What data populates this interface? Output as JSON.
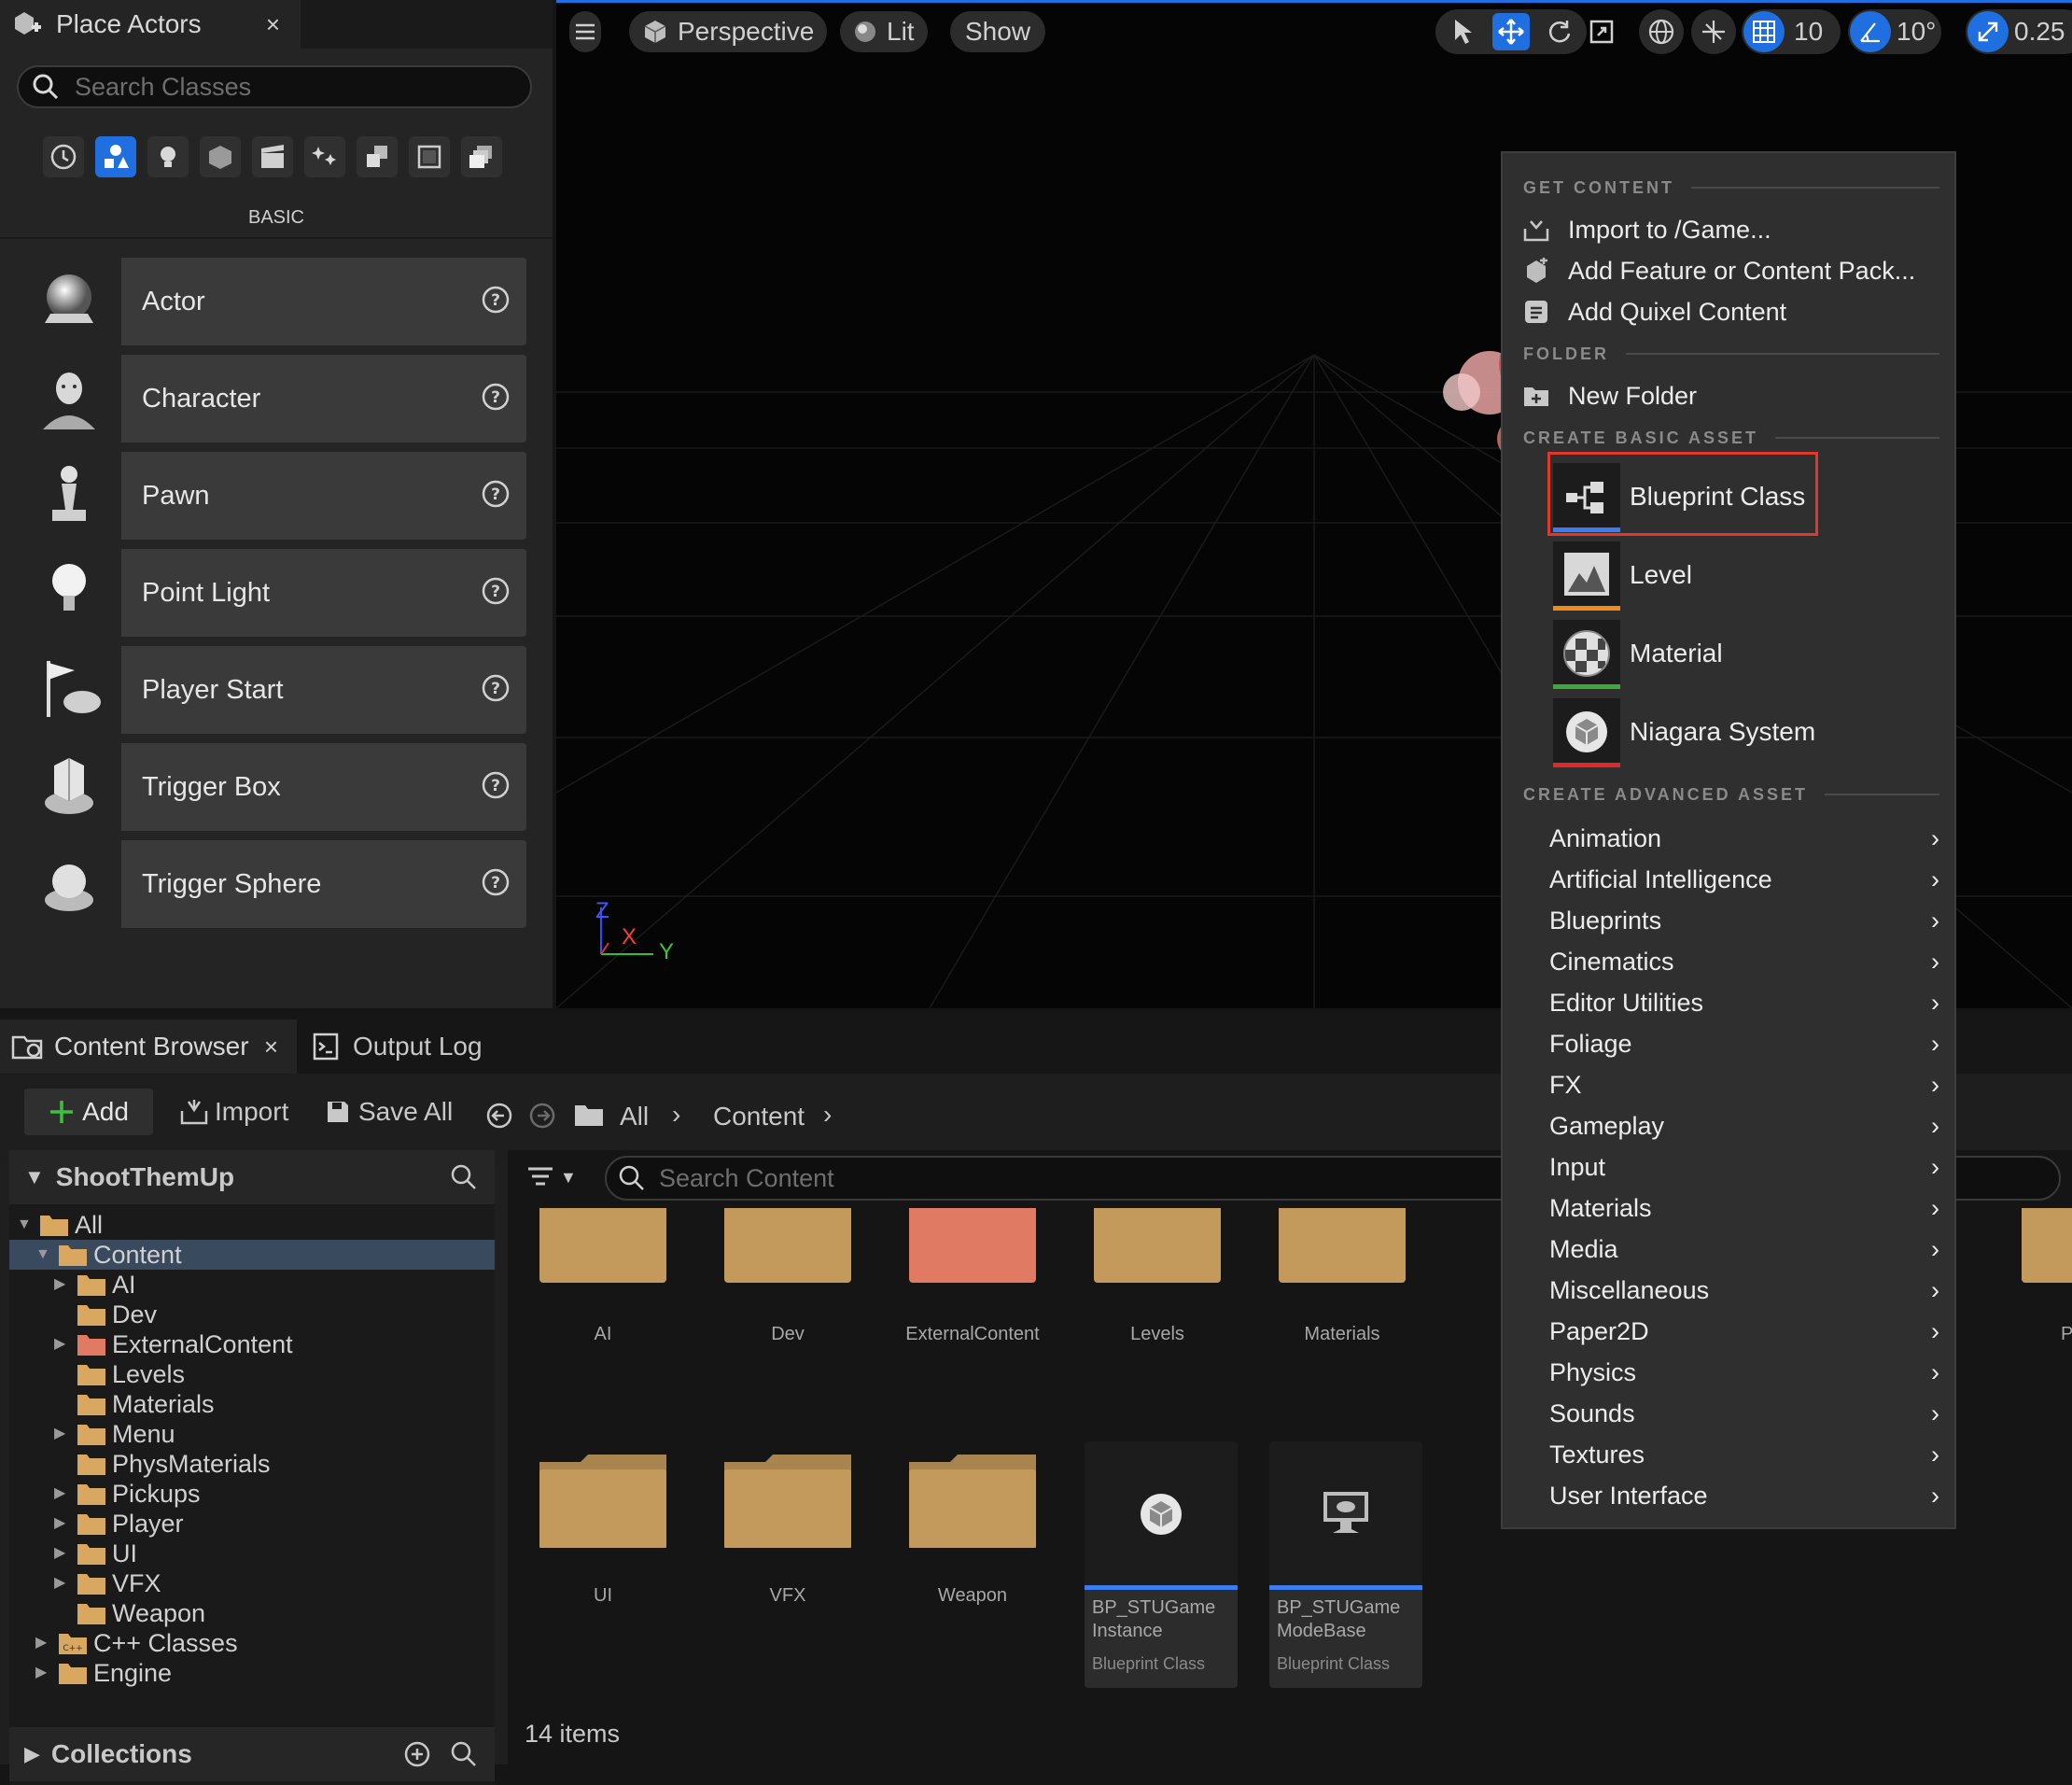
{
  "place_actors": {
    "tab_title": "Place Actors",
    "close": "×",
    "search_placeholder": "Search Classes",
    "category_label": "BASIC",
    "categories": [
      "recent-icon",
      "basic-icon",
      "lights-icon",
      "shapes-icon",
      "cinematic-icon",
      "visual-effects-icon",
      "geometry-icon",
      "volumes-icon",
      "all-classes-icon"
    ],
    "items": [
      {
        "label": "Actor",
        "icon": "sphere-icon"
      },
      {
        "label": "Character",
        "icon": "character-icon"
      },
      {
        "label": "Pawn",
        "icon": "pawn-icon"
      },
      {
        "label": "Point Light",
        "icon": "light-bulb-icon"
      },
      {
        "label": "Player Start",
        "icon": "player-start-icon"
      },
      {
        "label": "Trigger Box",
        "icon": "trigger-box-icon"
      },
      {
        "label": "Trigger Sphere",
        "icon": "trigger-sphere-icon"
      }
    ]
  },
  "viewport": {
    "perspective": "Perspective",
    "lit": "Lit",
    "show": "Show",
    "grid_snap": "10",
    "rotation_snap": "10°",
    "scale_snap": "0.25",
    "axis_z": "Z",
    "axis_x": "X",
    "axis_y": "Y"
  },
  "content_browser": {
    "tab_title": "Content Browser",
    "close": "×",
    "output_log": "Output Log",
    "add": "Add",
    "import": "Import",
    "save_all": "Save All",
    "breadcrumb": [
      "All",
      "Content"
    ],
    "project": "ShootThemUp",
    "search_placeholder": "Search Content",
    "collections": "Collections",
    "items_count": "14 items",
    "tree": [
      {
        "label": "All",
        "depth": 0,
        "expanded": true
      },
      {
        "label": "Content",
        "depth": 1,
        "expanded": true,
        "selected": true
      },
      {
        "label": "AI",
        "depth": 2,
        "arrow": true
      },
      {
        "label": "Dev",
        "depth": 2
      },
      {
        "label": "ExternalContent",
        "depth": 2,
        "arrow": true,
        "red": true
      },
      {
        "label": "Levels",
        "depth": 2
      },
      {
        "label": "Materials",
        "depth": 2
      },
      {
        "label": "Menu",
        "depth": 2,
        "arrow": true
      },
      {
        "label": "PhysMaterials",
        "depth": 2
      },
      {
        "label": "Pickups",
        "depth": 2,
        "arrow": true
      },
      {
        "label": "Player",
        "depth": 2,
        "arrow": true
      },
      {
        "label": "UI",
        "depth": 2,
        "arrow": true
      },
      {
        "label": "VFX",
        "depth": 2,
        "arrow": true
      },
      {
        "label": "Weapon",
        "depth": 2
      },
      {
        "label": "C++ Classes",
        "depth": 1,
        "arrow": true,
        "cpp": true
      },
      {
        "label": "Engine",
        "depth": 1,
        "arrow": true
      }
    ],
    "folders_row1": [
      "AI",
      "Dev",
      "ExternalContent",
      "Levels",
      "Materials"
    ],
    "folders_row2": [
      "UI",
      "VFX",
      "Weapon"
    ],
    "assets": [
      {
        "name_line1": "BP_STUGame",
        "name_line2": "Instance",
        "type": "Blueprint Class"
      },
      {
        "name_line1": "BP_STUGame",
        "name_line2": "ModeBase",
        "type": "Blueprint Class"
      }
    ],
    "partial_label": "P"
  },
  "context_menu": {
    "get_content": "GET CONTENT",
    "import": "Import to /Game...",
    "add_feature": "Add Feature or Content Pack...",
    "add_quixel": "Add Quixel Content",
    "folder": "FOLDER",
    "new_folder": "New Folder",
    "create_basic": "CREATE BASIC ASSET",
    "basic_assets": [
      {
        "label": "Blueprint Class",
        "color": "#3d7bf0"
      },
      {
        "label": "Level",
        "color": "#f08a1c"
      },
      {
        "label": "Material",
        "color": "#3aa83a"
      },
      {
        "label": "Niagara System",
        "color": "#e02828"
      }
    ],
    "create_advanced": "CREATE ADVANCED ASSET",
    "advanced": [
      "Animation",
      "Artificial Intelligence",
      "Blueprints",
      "Cinematics",
      "Editor Utilities",
      "Foliage",
      "FX",
      "Gameplay",
      "Input",
      "Materials",
      "Media",
      "Miscellaneous",
      "Paper2D",
      "Physics",
      "Sounds",
      "Textures",
      "User Interface"
    ]
  },
  "colors": {
    "accent": "#1f6fe0",
    "highlight_box": "#e0382a",
    "folder": "#c49a5c"
  }
}
